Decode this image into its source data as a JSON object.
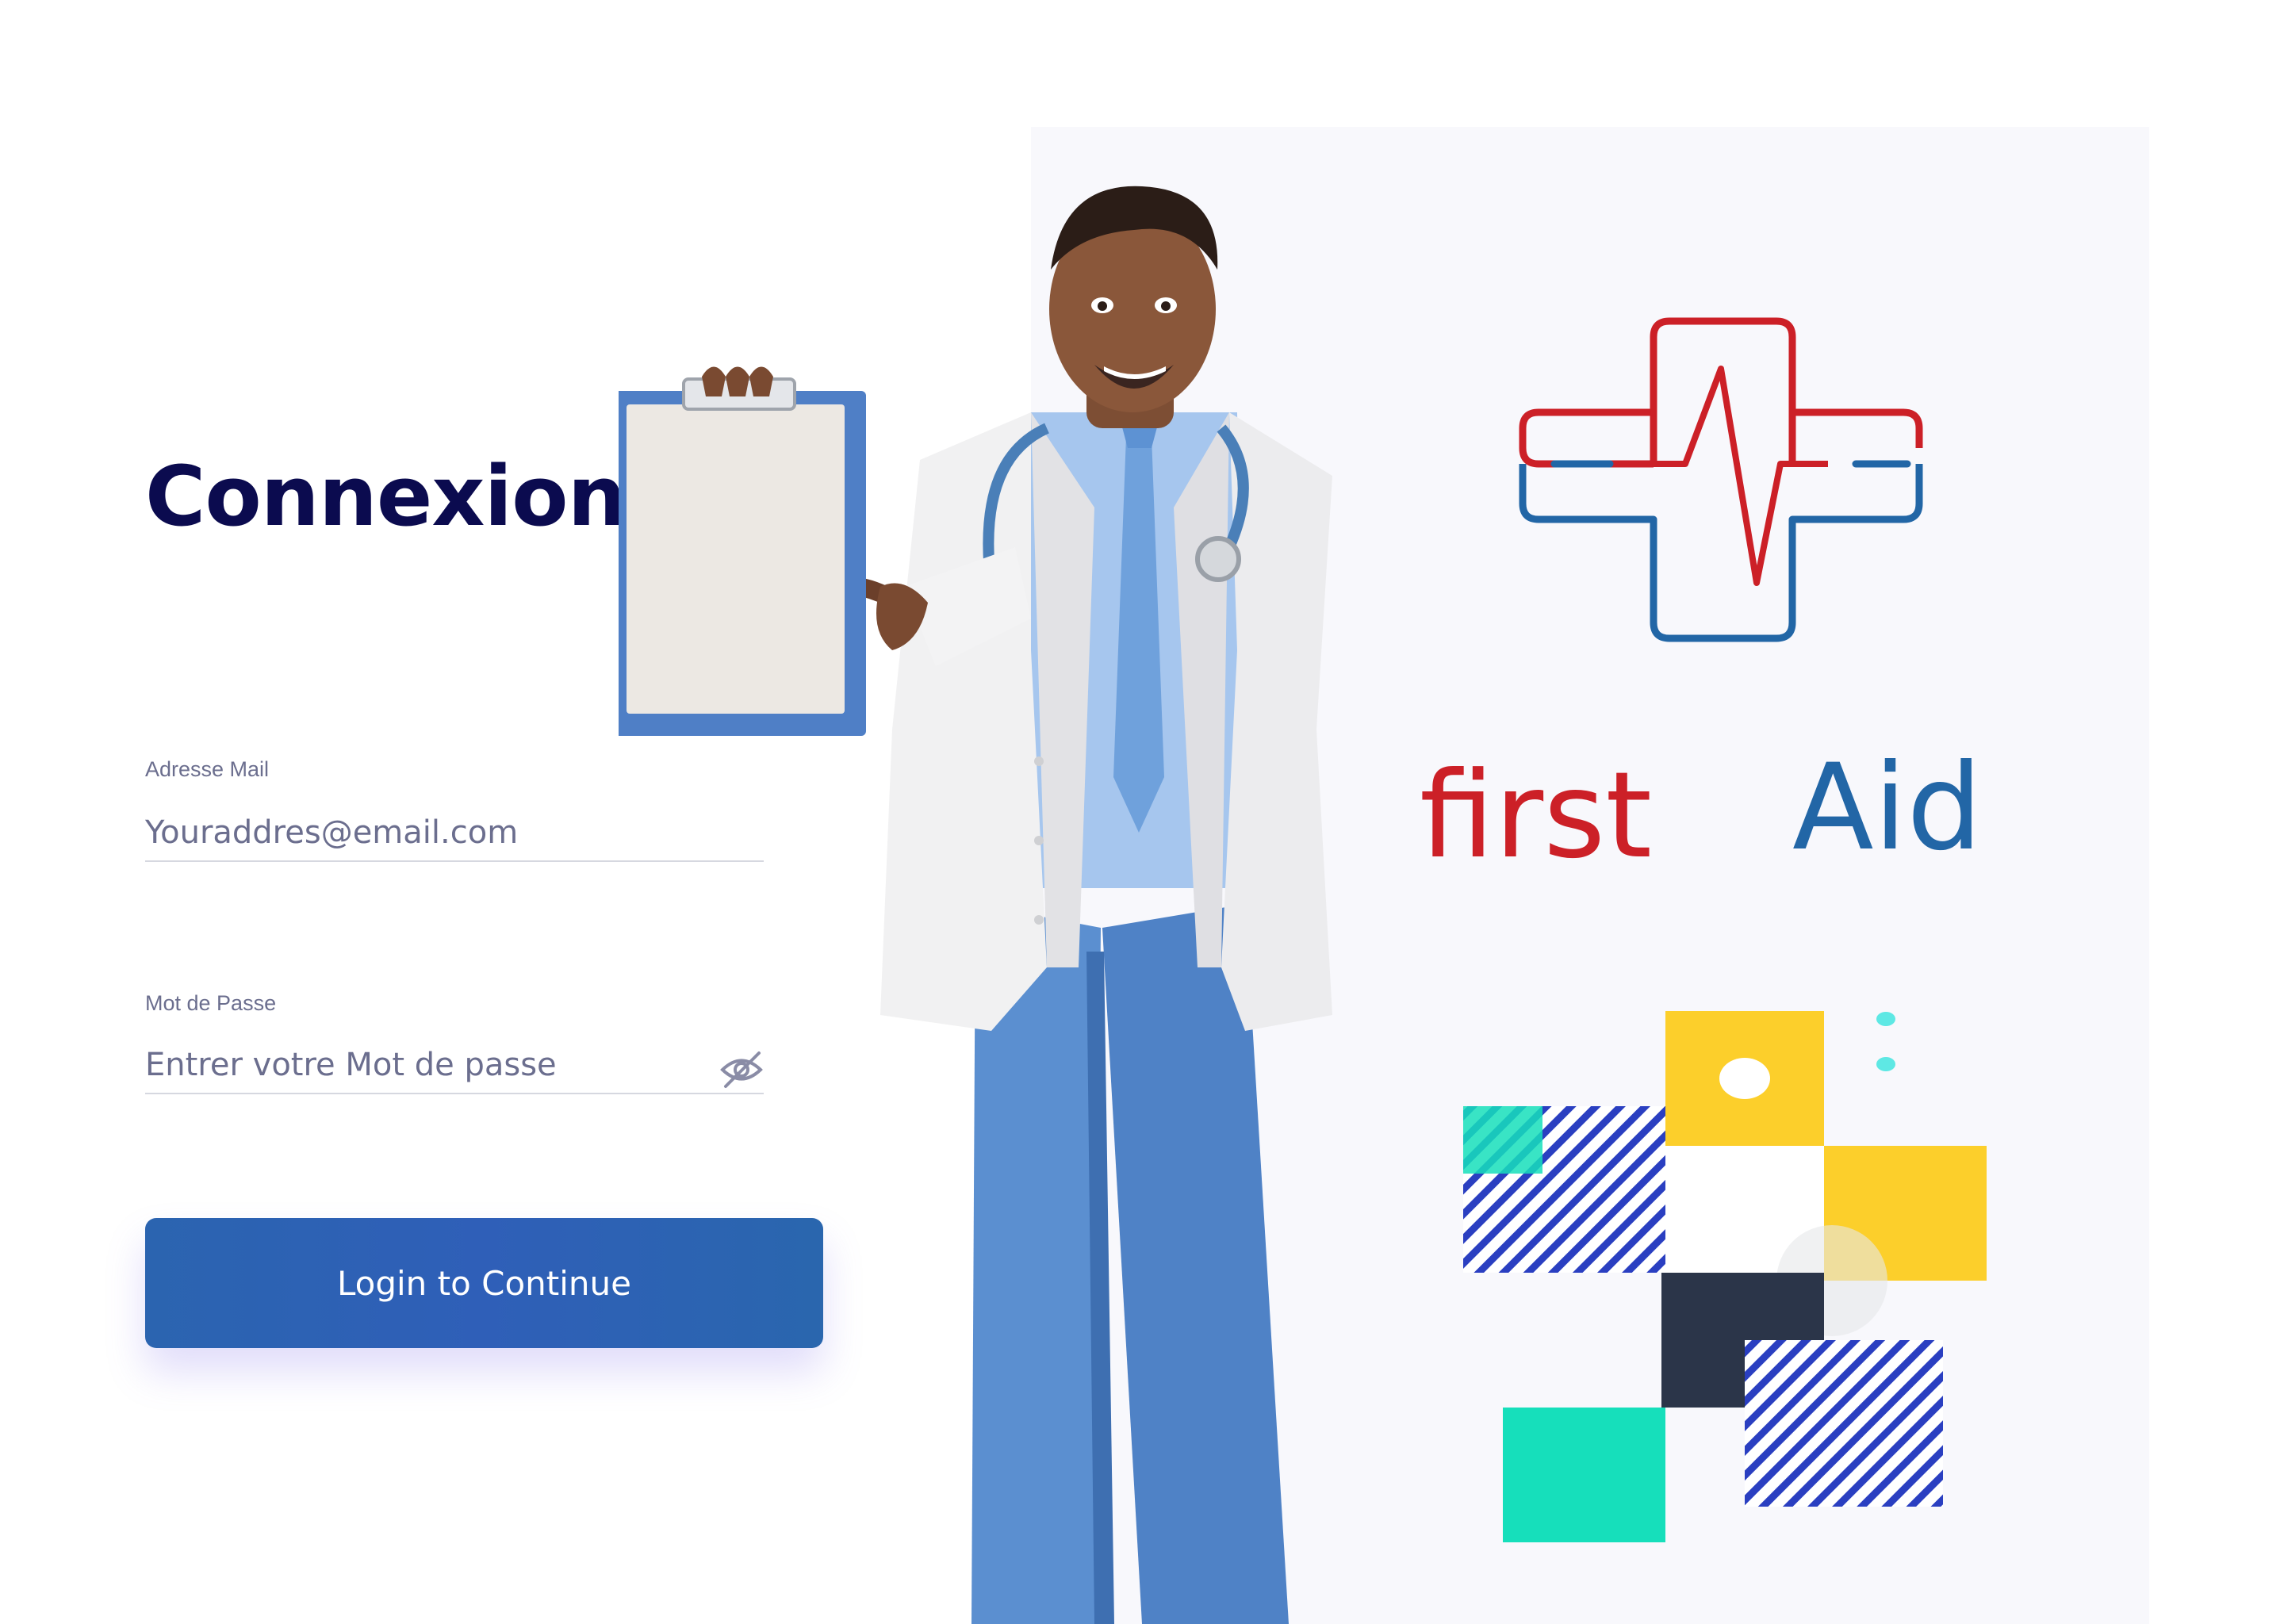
{
  "login": {
    "title": "Connexion",
    "email_label": "Adresse Mail",
    "email_placeholder": "Youraddres@email.com",
    "password_label": "Mot de Passe",
    "password_placeholder": "Entrer votre Mot de passe",
    "submit_label": "Login to Continue"
  },
  "brand": {
    "word1": "first",
    "word2": "Aid",
    "red": "#cc2027",
    "blue": "#2266a6"
  },
  "icons": {
    "password_toggle": "eye-slash-icon",
    "logo": "medical-cross-heartbeat-icon"
  },
  "colors": {
    "title": "#0b0b4f",
    "label": "#6b6e8e",
    "button": "#2d62b2",
    "accent_yellow": "#fccf2b",
    "accent_teal": "#16dfbb",
    "accent_navy": "#2b3549",
    "accent_stripe": "#2a3fc1"
  }
}
